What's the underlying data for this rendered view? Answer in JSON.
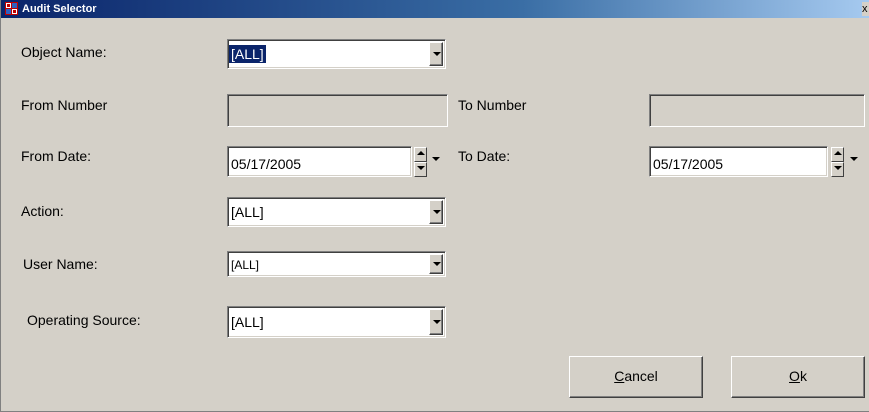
{
  "window": {
    "title": "Audit Selector",
    "close_glyph": "x",
    "icon": "app-grid-icon"
  },
  "labels": {
    "object_name": "Object Name:",
    "from_number": "From Number",
    "to_number": "To Number",
    "from_date": "From Date:",
    "to_date": "To Date:",
    "action": "Action:",
    "user_name": "User Name:",
    "operating_source": "Operating Source:"
  },
  "fields": {
    "object_name": "[ALL]",
    "from_number": "",
    "to_number": "",
    "from_date": "05/17/2005",
    "to_date": "05/17/2005",
    "action": "[ALL]",
    "user_name": "[ALL]",
    "operating_source": "[ALL]"
  },
  "buttons": {
    "cancel_first": "C",
    "cancel_rest": "ancel",
    "ok_first": "O",
    "ok_rest": "k"
  },
  "colors": {
    "face": "#d4d0c8",
    "titlebar": "#0a246a",
    "selection": "#0a246a"
  }
}
